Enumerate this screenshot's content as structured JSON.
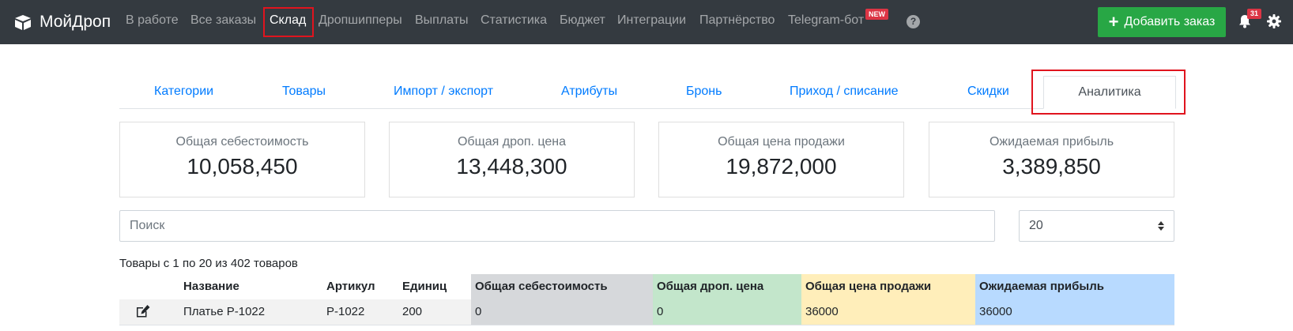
{
  "brand": {
    "name": "МойДроп",
    "icon": "box-icon"
  },
  "nav": {
    "items": [
      {
        "label": "В работе",
        "active": false
      },
      {
        "label": "Все заказы",
        "active": false
      },
      {
        "label": "Склад",
        "active": true
      },
      {
        "label": "Дропшипперы",
        "active": false
      },
      {
        "label": "Выплаты",
        "active": false
      },
      {
        "label": "Статистика",
        "active": false
      },
      {
        "label": "Бюджет",
        "active": false
      },
      {
        "label": "Интеграции",
        "active": false
      },
      {
        "label": "Партнёрство",
        "active": false
      },
      {
        "label": "Telegram-бот",
        "active": false
      }
    ],
    "new_badge": "NEW",
    "help_icon": "question-circle-icon",
    "add_order": "Добавить заказ",
    "notifications_count": "31",
    "settings_icon": "gear-icon"
  },
  "tabs": [
    {
      "label": "Категории"
    },
    {
      "label": "Товары"
    },
    {
      "label": "Импорт / экспорт"
    },
    {
      "label": "Атрибуты"
    },
    {
      "label": "Бронь"
    },
    {
      "label": "Приход / списание"
    },
    {
      "label": "Скидки"
    },
    {
      "label": "Аналитика",
      "active": true
    }
  ],
  "cards": [
    {
      "label": "Общая себестоимость",
      "value": "10,058,450"
    },
    {
      "label": "Общая дроп. цена",
      "value": "13,448,300"
    },
    {
      "label": "Общая цена продажи",
      "value": "19,872,000"
    },
    {
      "label": "Ожидаемая прибыль",
      "value": "3,389,850"
    }
  ],
  "search": {
    "placeholder": "Поиск",
    "value": ""
  },
  "page_size": {
    "selected": "20"
  },
  "pagination_info": "Товары с 1 по 20 из 402 товаров",
  "table": {
    "headers": [
      "",
      "Название",
      "Артикул",
      "Единиц",
      "Общая себестоимость",
      "Общая дроп. цена",
      "Общая цена продажи",
      "Ожидаемая прибыль"
    ],
    "header_colors": [
      "",
      "",
      "",
      "",
      "#d6d8db",
      "#c3e6cb",
      "#ffeeba",
      "#b8daff"
    ],
    "rows": [
      {
        "name": "Платье P-1022",
        "sku": "P-1022",
        "units": "200",
        "cost": "0",
        "drop": "0",
        "sale": "36000",
        "profit": "36000"
      }
    ]
  },
  "colors": {
    "navbar": "#343a40",
    "accent_green": "#28a745",
    "link_blue": "#007bff",
    "highlight_red": "#e0141e",
    "col_cost": "#d6d8db",
    "col_drop": "#c3e6cb",
    "col_sale": "#ffeeba",
    "col_profit": "#b8daff"
  }
}
